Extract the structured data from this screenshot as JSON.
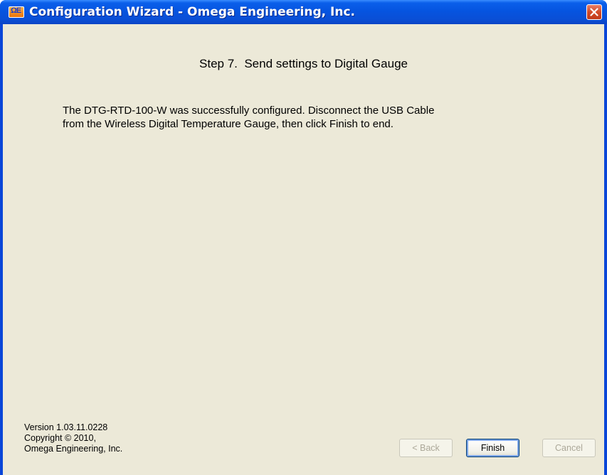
{
  "window": {
    "title": "Configuration Wizard - Omega Engineering, Inc.",
    "icon": "omega-app-icon",
    "icon_text": "ΩE"
  },
  "content": {
    "step_title": "Step 7.  Send settings to Digital Gauge",
    "message_lines": [
      "The DTG-RTD-100-W was successfully configured.  Disconnect the USB Cable",
      "from the Wireless Digital Temperature Gauge, then click Finish to end."
    ]
  },
  "footer": {
    "version": "Version 1.03.11.0228",
    "copyright": "Copyright © 2010,",
    "company": "Omega Engineering, Inc."
  },
  "buttons": {
    "back": "< Back",
    "finish": "Finish",
    "cancel": "Cancel"
  },
  "colors": {
    "titlebar": "#0654e0",
    "client_background": "#ece9d8",
    "close_button": "#d24a28"
  }
}
